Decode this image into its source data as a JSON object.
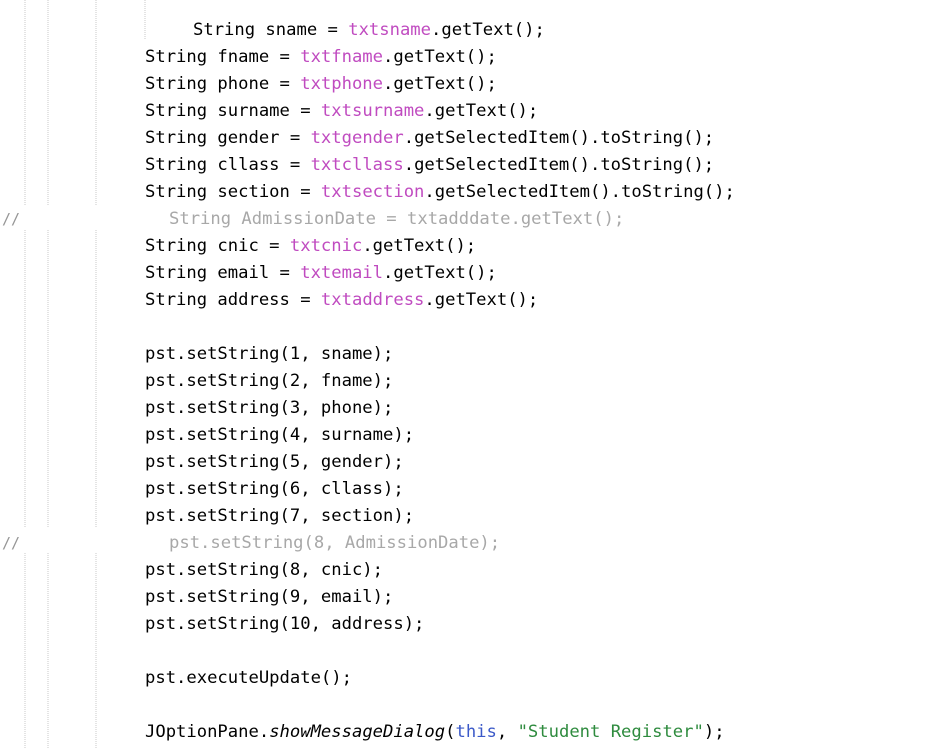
{
  "editor": {
    "lines": [
      {
        "indent": "inner",
        "parts": [
          {
            "t": "String sname = ",
            "c": "plain"
          },
          {
            "t": "txtsname",
            "c": "field"
          },
          {
            "t": ".getText();",
            "c": "plain"
          }
        ]
      },
      {
        "indent": "base",
        "parts": [
          {
            "t": "String fname = ",
            "c": "plain"
          },
          {
            "t": "txtfname",
            "c": "field"
          },
          {
            "t": ".getText();",
            "c": "plain"
          }
        ]
      },
      {
        "indent": "base",
        "parts": [
          {
            "t": "String phone = ",
            "c": "plain"
          },
          {
            "t": "txtphone",
            "c": "field"
          },
          {
            "t": ".getText();",
            "c": "plain"
          }
        ]
      },
      {
        "indent": "base",
        "parts": [
          {
            "t": "String surname = ",
            "c": "plain"
          },
          {
            "t": "txtsurname",
            "c": "field"
          },
          {
            "t": ".getText();",
            "c": "plain"
          }
        ]
      },
      {
        "indent": "base",
        "parts": [
          {
            "t": "String gender = ",
            "c": "plain"
          },
          {
            "t": "txtgender",
            "c": "field"
          },
          {
            "t": ".getSelectedItem().toString();",
            "c": "plain"
          }
        ]
      },
      {
        "indent": "base",
        "parts": [
          {
            "t": "String cllass = ",
            "c": "plain"
          },
          {
            "t": "txtcllass",
            "c": "field"
          },
          {
            "t": ".getSelectedItem().toString();",
            "c": "plain"
          }
        ]
      },
      {
        "indent": "base",
        "parts": [
          {
            "t": "String section = ",
            "c": "plain"
          },
          {
            "t": "txtsection",
            "c": "field"
          },
          {
            "t": ".getSelectedItem().toString();",
            "c": "plain"
          }
        ]
      },
      {
        "indent": "commented",
        "slash": "//",
        "parts": [
          {
            "t": "String AdmissionDate = txtadddate.getText();",
            "c": "commented"
          }
        ]
      },
      {
        "indent": "base",
        "parts": [
          {
            "t": "String cnic = ",
            "c": "plain"
          },
          {
            "t": "txtcnic",
            "c": "field"
          },
          {
            "t": ".getText();",
            "c": "plain"
          }
        ]
      },
      {
        "indent": "base",
        "parts": [
          {
            "t": "String email = ",
            "c": "plain"
          },
          {
            "t": "txtemail",
            "c": "field"
          },
          {
            "t": ".getText();",
            "c": "plain"
          }
        ]
      },
      {
        "indent": "base",
        "parts": [
          {
            "t": "String address = ",
            "c": "plain"
          },
          {
            "t": "txtaddress",
            "c": "field"
          },
          {
            "t": ".getText();",
            "c": "plain"
          }
        ]
      },
      {
        "indent": "base",
        "parts": []
      },
      {
        "indent": "base",
        "parts": [
          {
            "t": "pst.setString(1, sname);",
            "c": "plain"
          }
        ]
      },
      {
        "indent": "base",
        "parts": [
          {
            "t": "pst.setString(2, fname);",
            "c": "plain"
          }
        ]
      },
      {
        "indent": "base",
        "parts": [
          {
            "t": "pst.setString(3, phone);",
            "c": "plain"
          }
        ]
      },
      {
        "indent": "base",
        "parts": [
          {
            "t": "pst.setString(4, surname);",
            "c": "plain"
          }
        ]
      },
      {
        "indent": "base",
        "parts": [
          {
            "t": "pst.setString(5, gender);",
            "c": "plain"
          }
        ]
      },
      {
        "indent": "base",
        "parts": [
          {
            "t": "pst.setString(6, cllass);",
            "c": "plain"
          }
        ]
      },
      {
        "indent": "base",
        "parts": [
          {
            "t": "pst.setString(7, section);",
            "c": "plain"
          }
        ]
      },
      {
        "indent": "commented",
        "slash": "//",
        "parts": [
          {
            "t": "pst.setString(8, AdmissionDate);",
            "c": "commented"
          }
        ]
      },
      {
        "indent": "base",
        "parts": [
          {
            "t": "pst.setString(8, cnic);",
            "c": "plain"
          }
        ]
      },
      {
        "indent": "base",
        "parts": [
          {
            "t": "pst.setString(9, email);",
            "c": "plain"
          }
        ]
      },
      {
        "indent": "base",
        "parts": [
          {
            "t": "pst.setString(10, address);",
            "c": "plain"
          }
        ]
      },
      {
        "indent": "base",
        "parts": []
      },
      {
        "indent": "base",
        "parts": [
          {
            "t": "pst.executeUpdate();",
            "c": "plain"
          }
        ]
      },
      {
        "indent": "base",
        "parts": []
      },
      {
        "indent": "base",
        "parts": [
          {
            "t": "JOptionPane.",
            "c": "plain"
          },
          {
            "t": "showMessageDialog",
            "c": "italic"
          },
          {
            "t": "(",
            "c": "plain"
          },
          {
            "t": "this",
            "c": "kw"
          },
          {
            "t": ", ",
            "c": "plain"
          },
          {
            "t": "\"Student Register\"",
            "c": "str"
          },
          {
            "t": ");",
            "c": "plain"
          }
        ]
      }
    ]
  }
}
